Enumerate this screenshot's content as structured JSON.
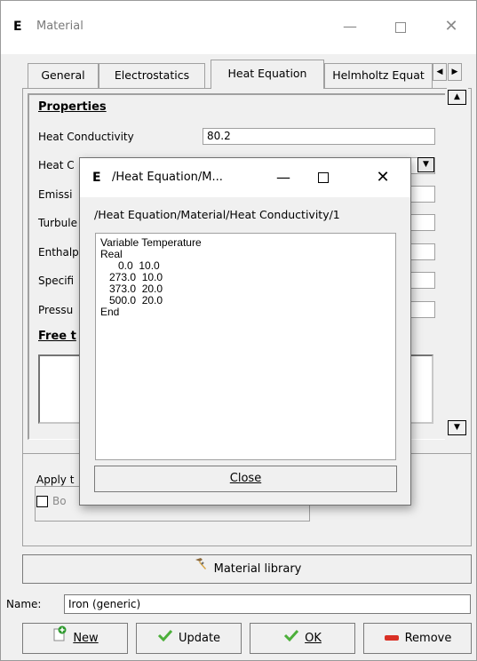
{
  "window": {
    "title": "Material",
    "icon": "elmer-e-icon",
    "minimize_label": "—",
    "close_label": "✕"
  },
  "tabs": [
    {
      "label": "General",
      "active": false
    },
    {
      "label": "Electrostatics",
      "active": false
    },
    {
      "label": "Heat Equation",
      "active": true
    },
    {
      "label": "Helmholtz Equat",
      "active": false
    }
  ],
  "tab_scroll": {
    "left": "◀",
    "right": "▶"
  },
  "properties": {
    "header": "Properties",
    "rows": [
      {
        "label": "Heat Conductivity",
        "value": "80.2"
      },
      {
        "label": "Heat C",
        "value": ""
      },
      {
        "label": "Emissi",
        "value": ""
      },
      {
        "label": "Turbule",
        "value": ""
      },
      {
        "label": "Enthalp",
        "value": ""
      },
      {
        "label": "Specifi",
        "value": ""
      },
      {
        "label": "Pressu",
        "value": ""
      }
    ],
    "free_text_header": "Free t"
  },
  "apply": {
    "label": "Apply t",
    "checkbox_label": "Bo"
  },
  "material_library_button": "Material library",
  "name": {
    "label": "Name:",
    "value": "Iron (generic)"
  },
  "buttons": {
    "new": "New",
    "update": "Update",
    "ok": "OK",
    "remove": "Remove"
  },
  "dialog": {
    "title": "/Heat Equation/M...",
    "path": "/Heat Equation/Material/Heat Conductivity/1",
    "content": "Variable Temperature\nReal\n      0.0  10.0\n   273.0  10.0\n   373.0  20.0\n   500.0  20.0\nEnd",
    "close_button": "Close",
    "minimize_label": "—",
    "close_label": "✕"
  },
  "colors": {
    "background": "#f0f0f0",
    "new_icon_green": "#2e9a2e",
    "check_green": "#4caf3a",
    "remove_red": "#d93025"
  }
}
